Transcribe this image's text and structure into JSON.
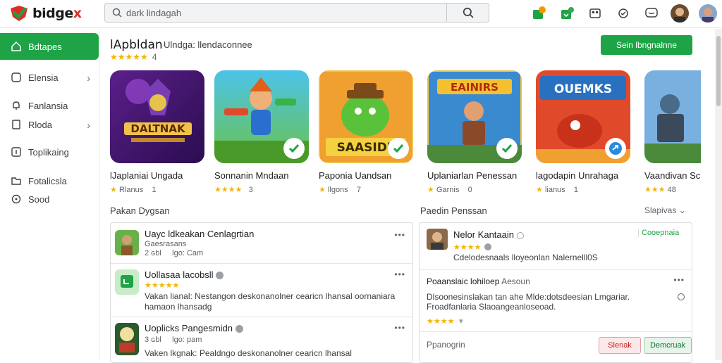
{
  "app": {
    "logo_text": "bidge",
    "logo_plus": "x"
  },
  "search": {
    "placeholder": "dark lindagah"
  },
  "sidebar": {
    "items": [
      {
        "label": "Bdtapes",
        "icon": "home-icon",
        "active": true
      },
      {
        "label": "Elensia",
        "icon": "tag-icon",
        "chevron": true
      },
      {
        "label": "Fanlansia",
        "icon": "bell-icon"
      },
      {
        "label": "Rloda",
        "icon": "list-icon",
        "chevron": true
      },
      {
        "label": "Toplikaing",
        "icon": "rank-icon"
      },
      {
        "label": "Fotalicsla",
        "icon": "folder-icon"
      },
      {
        "label": "Sood",
        "icon": "circle-icon"
      }
    ]
  },
  "header": {
    "title": "lApbldan",
    "subtitle": "Ulndga: llendaconnee",
    "stars": "★★★★★",
    "rating_count": "4",
    "primary_button": "Sein lbngnalnne"
  },
  "featured": [
    {
      "name": "lJaplaniai Ungada",
      "stars": "★",
      "meta": "Rlanus",
      "count": "1",
      "art_text": "DALTNAK",
      "badge": "check"
    },
    {
      "name": "Sonnanin Mndaan",
      "stars": "★★★★",
      "meta": "",
      "count": "3",
      "art_text": "",
      "badge": "check"
    },
    {
      "name": "Paponia Uandsan",
      "stars": "★",
      "meta": "llgons",
      "count": "7",
      "art_text": "SAASIDE",
      "badge": "check"
    },
    {
      "name": "Uplaniarlan Penessan",
      "stars": "★",
      "meta": "Garnis",
      "count": "0",
      "art_text": "EAINIRS",
      "badge": "check"
    },
    {
      "name": "lagodapin Unrahaga",
      "stars": "★",
      "meta": "lianus",
      "count": "1",
      "art_text": "OUEMKS",
      "badge": "share"
    },
    {
      "name": "Vaandivan Sc",
      "stars": "★★★",
      "meta": "",
      "count": "48",
      "art_text": "",
      "badge": ""
    }
  ],
  "sections": {
    "left_title": "Pakan Dygsan",
    "right_title": "Paedin Penssan",
    "filter_label": "Slapivas"
  },
  "list": [
    {
      "title": "Uayc ldkeakan Cenlagrtian",
      "sub1": "Gaesrasans",
      "sub2": "2 ɢbl",
      "sub3": "lgo: Cam",
      "text": "",
      "stars": ""
    },
    {
      "title": "Uollasaa lacobsll",
      "stars": "★★★★★",
      "text": "Vakan lianal: Nestangon deskonanolner cearicn lhansal oornaniara hamaon lhansadg",
      "sub1": "",
      "sub2": "",
      "sub3": ""
    },
    {
      "title": "Uoplicks Pangesmidn",
      "sub1": "",
      "sub2": "3 ɢbl",
      "sub3": "lgo: pam",
      "text": "Vaken lkgnak: Pealdngo deskonanolner cearicn lhansal",
      "stars": ""
    }
  ],
  "review": {
    "author": "Nelor Kantaain",
    "stars": "★★★★",
    "tag": "Cooepnaia",
    "line": "Cdelodesnaals lloyeonlan Nalernelll0S",
    "heading": "Poaanslaic lohiloep",
    "heading_sub": "Aesoun",
    "body": "Dlsoonesinslakan tan ahe Mlde:dotsdeesian Lmgariar. Froadfanlaria Slaoangeanloseoad.",
    "footer_label": "Ppanogrin",
    "btn_secondary": "Slenak",
    "btn_primary": "Demcruak",
    "review_stars": "★★★★"
  },
  "colors": {
    "accent": "#1ea446",
    "star": "#f4b400"
  }
}
